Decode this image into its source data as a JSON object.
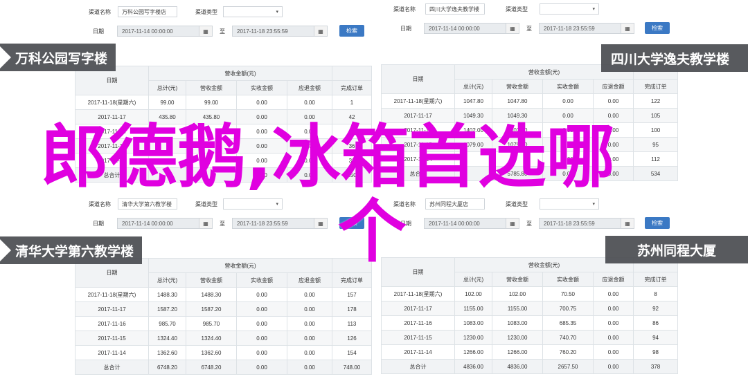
{
  "labels": {
    "channel": "渠道名称",
    "channel_type": "渠道类型",
    "date": "日期",
    "to": "至",
    "search": "检索",
    "select_caret": "▾",
    "calendar_icon": "▦"
  },
  "header": {
    "date_col": "日期",
    "group": "营收金额(元)",
    "cols": [
      "总计(元)",
      "营收金额",
      "实收金额",
      "应退金额",
      "完成订单"
    ]
  },
  "panels": {
    "tl": {
      "channel": "万科公园写字楼店",
      "start": "2017-11-14 00:00:00",
      "end": "2017-11-18 23:55:59",
      "title": "万科公园写字楼",
      "rows": [
        [
          "2017-11-18(星期六)",
          "99.00",
          "99.00",
          "0.00",
          "0.00",
          "1"
        ],
        [
          "2017-11-17",
          "435.80",
          "435.80",
          "0.00",
          "0.00",
          "42"
        ],
        [
          "2017-11-16",
          "",
          "",
          "0.00",
          "0.00",
          "38"
        ],
        [
          "2017-11-15",
          "",
          "",
          "0.00",
          "0.00",
          "36"
        ],
        [
          "2017-11-14",
          "",
          "",
          "0.00",
          "0.00",
          "33"
        ],
        [
          "总合计",
          "",
          "",
          "0.00",
          "0.00",
          "150"
        ]
      ]
    },
    "tr": {
      "channel": "四川大学逸夫教学楼",
      "start": "2017-11-14 00:00:00",
      "end": "2017-11-18 23:55:59",
      "title": "四川大学逸夫教学楼",
      "rows": [
        [
          "2017-11-18(星期六)",
          "1047.80",
          "1047.80",
          "0.00",
          "0.00",
          "122"
        ],
        [
          "2017-11-17",
          "1049.30",
          "1049.30",
          "0.00",
          "0.00",
          "105"
        ],
        [
          "2017-11-16",
          "1402.00",
          "1402.00",
          "0.00",
          "0.00",
          "100"
        ],
        [
          "2017-11-15",
          "1079.00",
          "1079.00",
          "0.00",
          "0.00",
          "95"
        ],
        [
          "2017-11-14",
          "",
          "",
          "0.00",
          "0.00",
          "112"
        ],
        [
          "总合计",
          "",
          "5785.80",
          "0.00",
          "0.00",
          "534"
        ]
      ]
    },
    "bl": {
      "channel": "清华大学第六教学楼",
      "start": "2017-11-14 00:00:00",
      "end": "2017-11-18 23:55:59",
      "title": "清华大学第六教学楼",
      "rows": [
        [
          "2017-11-18(星期六)",
          "1488.30",
          "1488.30",
          "0.00",
          "0.00",
          "157"
        ],
        [
          "2017-11-17",
          "1587.20",
          "1587.20",
          "0.00",
          "0.00",
          "178"
        ],
        [
          "2017-11-16",
          "985.70",
          "985.70",
          "0.00",
          "0.00",
          "113"
        ],
        [
          "2017-11-15",
          "1324.40",
          "1324.40",
          "0.00",
          "0.00",
          "126"
        ],
        [
          "2017-11-14",
          "1362.60",
          "1362.60",
          "0.00",
          "0.00",
          "154"
        ],
        [
          "总合计",
          "6748.20",
          "6748.20",
          "0.00",
          "0.00",
          "748.00"
        ]
      ]
    },
    "br": {
      "channel": "苏州同程大厦店",
      "start": "2017-11-14 00:00:00",
      "end": "2017-11-18 23:55:59",
      "title": "苏州同程大厦",
      "rows": [
        [
          "2017-11-18(星期六)",
          "102.00",
          "102.00",
          "70.50",
          "0.00",
          "8"
        ],
        [
          "2017-11-17",
          "1155.00",
          "1155.00",
          "700.75",
          "0.00",
          "92"
        ],
        [
          "2017-11-16",
          "1083.00",
          "1083.00",
          "685.35",
          "0.00",
          "86"
        ],
        [
          "2017-11-15",
          "1230.00",
          "1230.00",
          "740.70",
          "0.00",
          "94"
        ],
        [
          "2017-11-14",
          "1266.00",
          "1266.00",
          "760.20",
          "0.00",
          "98"
        ],
        [
          "总合计",
          "4836.00",
          "4836.00",
          "2657.50",
          "0.00",
          "378"
        ]
      ]
    }
  },
  "overlay": {
    "line1": "郎德鹅,冰箱首选哪",
    "line2": "个"
  }
}
